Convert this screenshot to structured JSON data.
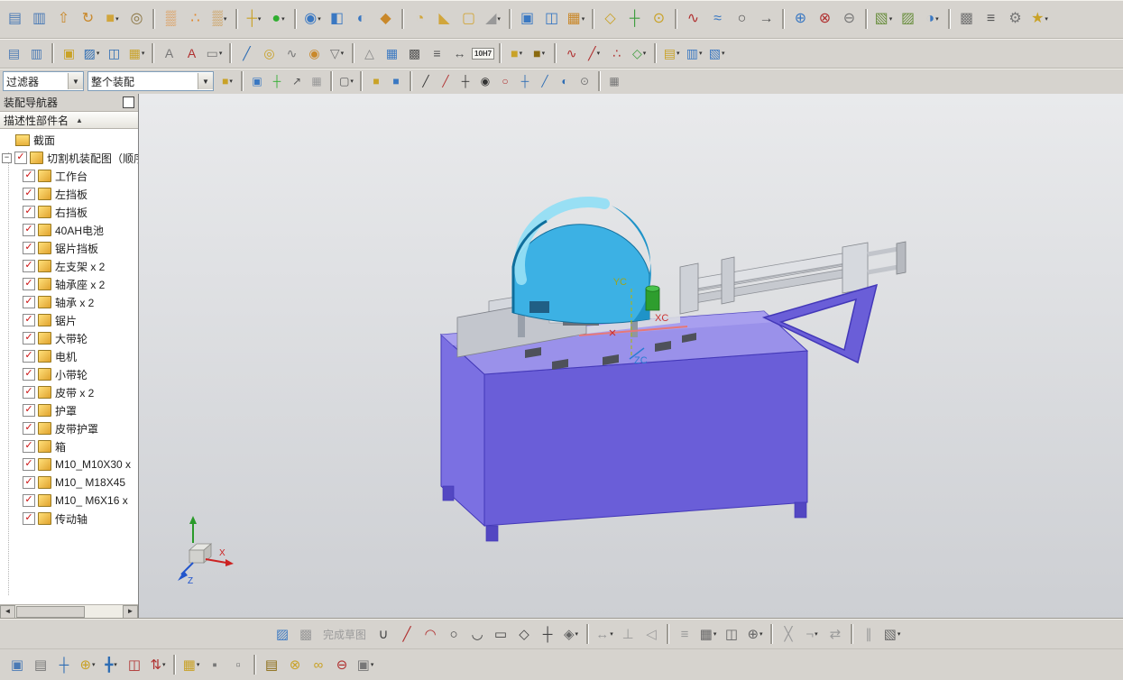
{
  "toolbars": {
    "row1": {
      "items": [
        {
          "name": "through-curves-icon",
          "glyph": "▤",
          "color": "#4a7ab5"
        },
        {
          "name": "swept-icon",
          "glyph": "▥",
          "color": "#4a7ab5"
        },
        {
          "name": "extrude-icon",
          "glyph": "⇧",
          "color": "#c9882a"
        },
        {
          "name": "revolve-icon",
          "glyph": "↻",
          "color": "#c9882a"
        },
        {
          "name": "block-icon",
          "glyph": "■",
          "color": "#d1a63c",
          "dd": true
        },
        {
          "name": "hole-icon",
          "glyph": "◎",
          "color": "#8a7440"
        },
        {
          "sep": true
        },
        {
          "name": "pattern-feature-icon",
          "glyph": "▒",
          "color": "#e0862a"
        },
        {
          "name": "point-set-icon",
          "glyph": "∴",
          "color": "#e0862a"
        },
        {
          "name": "pattern-face-icon",
          "glyph": "▒",
          "color": "#c9882a",
          "dd": true
        },
        {
          "sep": true
        },
        {
          "name": "datum-csys-icon",
          "glyph": "┼",
          "color": "#c9a227",
          "dd": true
        },
        {
          "name": "point-icon",
          "glyph": "●",
          "color": "#2fae2f",
          "dd": true
        },
        {
          "sep": true
        },
        {
          "name": "unite-icon",
          "glyph": "◉",
          "color": "#3a78c2",
          "dd": true
        },
        {
          "name": "subtract-icon",
          "glyph": "◧",
          "color": "#3a78c2"
        },
        {
          "name": "intersect-icon",
          "glyph": "◐",
          "color": "#3a78c2"
        },
        {
          "name": "sew-icon",
          "glyph": "◆",
          "color": "#c9882a"
        },
        {
          "sep": true
        },
        {
          "name": "edge-blend-icon",
          "glyph": "◔",
          "color": "#d1a63c"
        },
        {
          "name": "chamfer-icon",
          "glyph": "◣",
          "color": "#d1a63c"
        },
        {
          "name": "shell-icon",
          "glyph": "▢",
          "color": "#d1a63c"
        },
        {
          "name": "draft-icon",
          "glyph": "◢",
          "color": "#999999",
          "dd": true
        },
        {
          "sep": true
        },
        {
          "name": "offset-surface-icon",
          "glyph": "▣",
          "color": "#3a78c2"
        },
        {
          "name": "mirror-feature-icon",
          "glyph": "◫",
          "color": "#3a78c2"
        },
        {
          "name": "pattern-geometry-icon",
          "glyph": "▦",
          "color": "#c9882a",
          "dd": true
        },
        {
          "sep": true
        },
        {
          "name": "datum-plane-icon",
          "glyph": "◇",
          "color": "#c9a227"
        },
        {
          "name": "datum-axis-icon",
          "glyph": "┼",
          "color": "#3f9d3f"
        },
        {
          "name": "datum-point-icon",
          "glyph": "⊙",
          "color": "#c9a227"
        },
        {
          "sep": true
        },
        {
          "name": "studio-spline-icon",
          "glyph": "∿",
          "color": "#b03030"
        },
        {
          "name": "fit-curve-icon",
          "glyph": "≈",
          "color": "#3a78c2"
        },
        {
          "name": "arc-circle-icon",
          "glyph": "○",
          "color": "#555555"
        },
        {
          "name": "project-curve-icon",
          "glyph": "→",
          "color": "#555555"
        },
        {
          "sep": true
        },
        {
          "name": "wave-link-icon",
          "glyph": "⊕",
          "color": "#3a78c2"
        },
        {
          "name": "delete-face-icon",
          "glyph": "⊗",
          "color": "#b03030"
        },
        {
          "name": "suppress-feature-icon",
          "glyph": "⊖",
          "color": "#777777"
        },
        {
          "sep": true
        },
        {
          "name": "move-face-icon",
          "glyph": "▧",
          "color": "#6a8f3f",
          "dd": true
        },
        {
          "name": "pull-face-icon",
          "glyph": "▨",
          "color": "#6a8f3f"
        },
        {
          "name": "replace-face-icon",
          "glyph": "◑",
          "color": "#3a78c2",
          "dd": true
        },
        {
          "sep": true
        },
        {
          "name": "measure-icon",
          "glyph": "▩",
          "color": "#777777"
        },
        {
          "name": "expressions-icon",
          "glyph": "≡",
          "color": "#555555"
        },
        {
          "name": "settings-icon",
          "glyph": "⚙",
          "color": "#777777"
        },
        {
          "name": "favorites-icon",
          "glyph": "★",
          "color": "#c9a227",
          "dd": true
        }
      ]
    },
    "row2": {
      "items": [
        {
          "name": "view-layout-icon",
          "glyph": "▤",
          "color": "#4a7ab5"
        },
        {
          "name": "view-sheet-icon",
          "glyph": "▥",
          "color": "#4a7ab5"
        },
        {
          "sep": true
        },
        {
          "name": "named-views-icon",
          "glyph": "▣",
          "color": "#c9a227"
        },
        {
          "name": "edit-section-icon",
          "glyph": "▨",
          "color": "#2e6db4",
          "dd": true
        },
        {
          "name": "window-split-icon",
          "glyph": "◫",
          "color": "#2e6db4"
        },
        {
          "name": "layer-settings-icon",
          "glyph": "▦",
          "color": "#c9a227",
          "dd": true
        },
        {
          "sep": true
        },
        {
          "name": "annotation-plain-icon",
          "glyph": "A",
          "color": "#777777"
        },
        {
          "name": "annotation-style-icon",
          "glyph": "A",
          "color": "#b03030"
        },
        {
          "name": "note-icon",
          "glyph": "▭",
          "color": "#777777",
          "dd": true
        },
        {
          "sep": true
        },
        {
          "name": "pen-icon",
          "glyph": "╱",
          "color": "#2e6db4"
        },
        {
          "name": "washer-icon",
          "glyph": "◎",
          "color": "#c9a227"
        },
        {
          "name": "spring-icon",
          "glyph": "∿",
          "color": "#777777"
        },
        {
          "name": "coil-icon",
          "glyph": "◉",
          "color": "#c9882a"
        },
        {
          "name": "surface-finish-icon",
          "glyph": "▽",
          "color": "#777777",
          "dd": true
        },
        {
          "sep": true
        },
        {
          "name": "datum-feature-symbol-icon",
          "glyph": "△",
          "color": "#888888"
        },
        {
          "name": "grid-icon",
          "glyph": "▦",
          "color": "#3a78c2"
        },
        {
          "name": "checkerboard-icon",
          "glyph": "▩",
          "color": "#555555"
        },
        {
          "name": "parts-list-icon",
          "glyph": "≡",
          "color": "#555555"
        },
        {
          "name": "dimension-icon",
          "glyph": "↔",
          "color": "#555555"
        },
        {
          "name": "tolerance-10h7-icon",
          "badge": "10H7"
        },
        {
          "sep": true
        },
        {
          "name": "feature-group-icon",
          "glyph": "■",
          "color": "#c9a227",
          "dd": true
        },
        {
          "name": "feature-group-alt-icon",
          "glyph": "■",
          "color": "#8a6a10",
          "dd": true
        },
        {
          "sep": true
        },
        {
          "name": "edit-spline-icon",
          "glyph": "∿",
          "color": "#b03030"
        },
        {
          "name": "edit-pole-icon",
          "glyph": "╱",
          "color": "#b03030",
          "dd": true
        },
        {
          "name": "curve-points-icon",
          "glyph": "∴",
          "color": "#b03030"
        },
        {
          "name": "curve-analysis-icon",
          "glyph": "◇",
          "color": "#3f9d3f",
          "dd": true
        },
        {
          "sep": true
        },
        {
          "name": "sheet-layers-icon",
          "glyph": "▤",
          "color": "#c9a227",
          "dd": true
        },
        {
          "name": "layer-visible-icon",
          "glyph": "▥",
          "color": "#3a78c2",
          "dd": true
        },
        {
          "name": "layer-category-icon",
          "glyph": "▧",
          "color": "#3a78c2",
          "dd": true
        }
      ]
    },
    "row3": {
      "filter_value": "过滤器",
      "scope_value": "整个装配",
      "items": [
        {
          "name": "find-in-assembly-icon",
          "glyph": "■",
          "color": "#c9a227",
          "dd": true
        },
        {
          "sep": true
        },
        {
          "name": "add-snapshot-icon",
          "glyph": "▣",
          "color": "#3a78c2"
        },
        {
          "name": "create-point-icon",
          "glyph": "┼",
          "color": "#2fae2f"
        },
        {
          "name": "vector-icon",
          "glyph": "↗",
          "color": "#555555"
        },
        {
          "name": "work-grid-icon",
          "glyph": "▦",
          "color": "#999999"
        },
        {
          "sep": true
        },
        {
          "name": "rectangle-select-icon",
          "glyph": "▢",
          "color": "#555555",
          "dd": true
        },
        {
          "sep": true
        },
        {
          "name": "solid-select-icon",
          "glyph": "■",
          "color": "#c9a227"
        },
        {
          "name": "face-select-icon",
          "glyph": "■",
          "color": "#3a78c2"
        },
        {
          "sep": true
        },
        {
          "name": "snap-endpoint-icon",
          "glyph": "╱",
          "color": "#333333"
        },
        {
          "name": "snap-midpoint-icon",
          "glyph": "╱",
          "color": "#b03030"
        },
        {
          "name": "snap-intersection-icon",
          "glyph": "┼",
          "color": "#333333"
        },
        {
          "name": "snap-arc-center-icon",
          "glyph": "◉",
          "color": "#333333"
        },
        {
          "name": "snap-quadrant-icon",
          "glyph": "○",
          "color": "#b03030"
        },
        {
          "name": "snap-existing-point-icon",
          "glyph": "┼",
          "color": "#2e6db4"
        },
        {
          "name": "snap-point-on-curve-icon",
          "glyph": "╱",
          "color": "#2e6db4"
        },
        {
          "name": "snap-point-on-face-icon",
          "glyph": "◐",
          "color": "#2e6db4"
        },
        {
          "name": "snap-bounded-plane-icon",
          "glyph": "⊙",
          "color": "#777777"
        },
        {
          "sep": true
        },
        {
          "name": "grid-snap-icon",
          "glyph": "▦",
          "color": "#777777"
        }
      ]
    },
    "bottom_sketch": {
      "items": [
        {
          "name": "sketch-tools-icon",
          "glyph": "▨",
          "color": "#3a78c2"
        },
        {
          "name": "display-sketch-constraints-icon",
          "glyph": "▩",
          "color": "#999999"
        },
        {
          "name": "finish-sketch-button",
          "text": "完成草图",
          "disabled": true
        },
        {
          "name": "profile-icon",
          "glyph": "∪",
          "color": "#444444"
        },
        {
          "name": "line-icon",
          "glyph": "╱",
          "color": "#b03030"
        },
        {
          "name": "arc-icon",
          "glyph": "◠",
          "color": "#b03030"
        },
        {
          "name": "circle-icon",
          "glyph": "○",
          "color": "#444444"
        },
        {
          "name": "fillet-icon",
          "glyph": "◡",
          "color": "#444444"
        },
        {
          "name": "rectangle-icon",
          "glyph": "▭",
          "color": "#444444"
        },
        {
          "name": "polygon-icon",
          "glyph": "◇",
          "color": "#444444"
        },
        {
          "name": "sketch-point-icon",
          "glyph": "┼",
          "color": "#444444"
        },
        {
          "name": "more-curves-icon",
          "glyph": "◈",
          "color": "#666666",
          "dd": true
        },
        {
          "sep": true
        },
        {
          "name": "rapid-dimension-icon",
          "glyph": "↔",
          "disabled": true,
          "dd": true
        },
        {
          "name": "geometric-constraints-icon",
          "glyph": "⊥",
          "disabled": true
        },
        {
          "name": "make-symmetric-icon",
          "glyph": "◁",
          "disabled": true
        },
        {
          "sep": true
        },
        {
          "name": "offset-curve-icon",
          "glyph": "≡",
          "disabled": true
        },
        {
          "name": "pattern-curve-icon",
          "glyph": "▦",
          "color": "#666666",
          "dd": true
        },
        {
          "name": "mirror-curve-icon",
          "glyph": "◫",
          "color": "#666666"
        },
        {
          "name": "intersection-point-icon",
          "glyph": "⊕",
          "color": "#666666",
          "dd": true
        },
        {
          "sep": true
        },
        {
          "name": "trim-curve-icon",
          "glyph": "╳",
          "disabled": true
        },
        {
          "name": "corner-icon",
          "glyph": "¬",
          "disabled": true,
          "dd": true
        },
        {
          "name": "move-curve-icon",
          "glyph": "⇄",
          "disabled": true
        },
        {
          "sep": true
        },
        {
          "name": "constraints-display-icon",
          "glyph": "∥",
          "disabled": true
        },
        {
          "name": "sketch-settings-icon",
          "glyph": "▧",
          "color": "#666666",
          "dd": true
        }
      ]
    },
    "bottom_assembly": {
      "items": [
        {
          "name": "open-in-window-icon",
          "glyph": "▣",
          "color": "#4a7ab5"
        },
        {
          "name": "component-list-icon",
          "glyph": "▤",
          "color": "#777777"
        },
        {
          "name": "new-component-icon",
          "glyph": "┼",
          "color": "#2e6db4"
        },
        {
          "name": "add-component-icon",
          "glyph": "⊕",
          "color": "#c9a227",
          "dd": true
        },
        {
          "name": "move-component-icon",
          "glyph": "╋",
          "color": "#2e6db4",
          "dd": true
        },
        {
          "name": "replace-component-icon",
          "glyph": "◫",
          "color": "#b03030"
        },
        {
          "name": "assembly-sequence-icon",
          "glyph": "⇅",
          "color": "#b03030",
          "dd": true
        },
        {
          "sep": true
        },
        {
          "name": "pattern-component-icon",
          "glyph": "▦",
          "color": "#c9a227",
          "dd": true
        },
        {
          "name": "suppress-component-icon",
          "glyph": "▪",
          "color": "#777777"
        },
        {
          "name": "show-component-icon",
          "glyph": "▫",
          "color": "#777777"
        },
        {
          "sep": true
        },
        {
          "name": "reference-set-icon",
          "glyph": "▤",
          "color": "#8a6a10"
        },
        {
          "name": "assembly-constraints-icon",
          "glyph": "⊗",
          "color": "#c9a227"
        },
        {
          "name": "interpart-links-icon",
          "glyph": "∞",
          "color": "#c9a227"
        },
        {
          "name": "break-link-icon",
          "glyph": "⊖",
          "color": "#b03030"
        },
        {
          "name": "wave-geometry-linker-icon",
          "glyph": "▣",
          "color": "#777777",
          "dd": true
        }
      ]
    }
  },
  "navigator": {
    "title": "装配导航器",
    "column_header": "描述性部件名",
    "sort_glyph": "▲",
    "expander_glyph": "−",
    "section_label": "截面",
    "root_label": "切割机装配图（顺序",
    "scrollbar": {
      "left": "◄",
      "right": "►"
    },
    "items": [
      "工作台",
      "左挡板",
      "右挡板",
      "40AH电池",
      "锯片挡板",
      "左支架 x 2",
      "轴承座 x 2",
      "轴承 x 2",
      "锯片",
      "大带轮",
      "电机",
      "小带轮",
      "皮带 x 2",
      "护罩",
      "皮带护罩",
      "箱",
      "M10_M10X30 x",
      "M10_ M18X45",
      "M10_ M6X16 x",
      "传动轴"
    ]
  },
  "viewport": {
    "wcs": {
      "xc": "XC",
      "yc": "YC",
      "zc": "ZC"
    },
    "triad": {
      "x": "X",
      "z": "Z"
    },
    "colors": {
      "machine_front": "#6a5ed8",
      "machine_top": "#9a91ea",
      "machine_side": "#7b70e2",
      "dome": "#3cb1e4",
      "dome_shade": "#1f93c8",
      "rail": "#dfe1e5",
      "accent_red": "#cc3333",
      "accent_green": "#2e9e2e",
      "accent_blue": "#2b7cd3"
    }
  }
}
